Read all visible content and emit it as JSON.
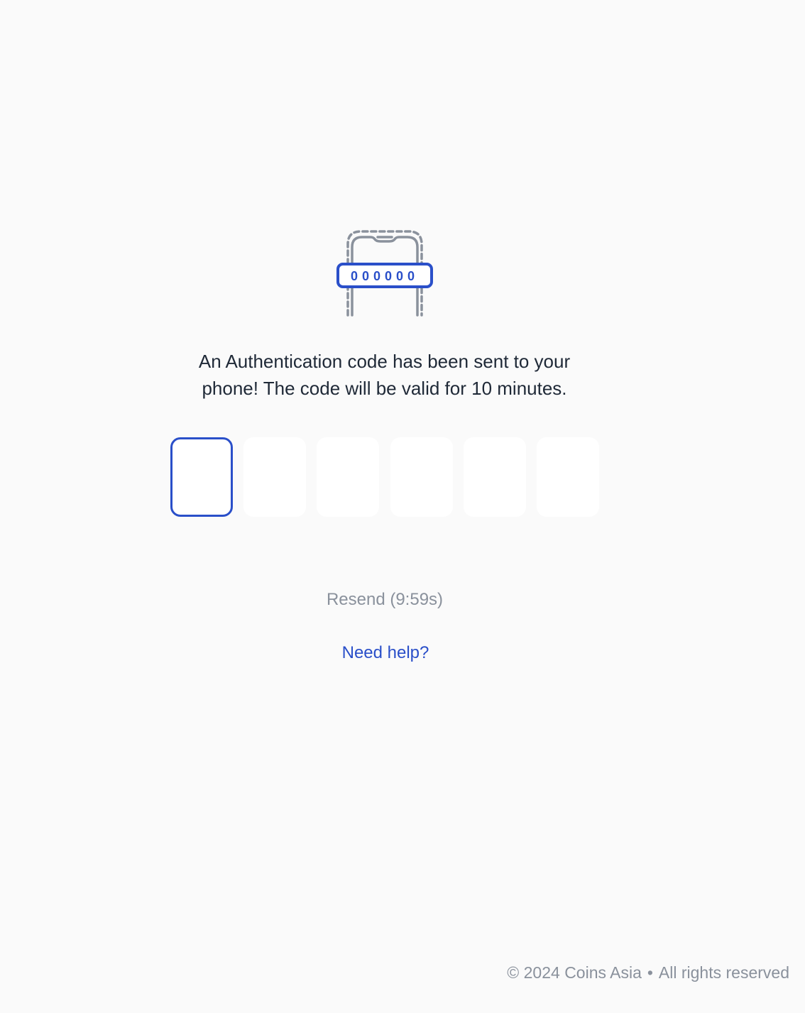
{
  "verification": {
    "message": "An Authentication code has been sent to your phone! The code will be valid for 10 minutes.",
    "code_digits": [
      "",
      "",
      "",
      "",
      "",
      ""
    ],
    "illustration_code": "000000",
    "resend_label": "Resend (9:59s)",
    "help_label": "Need help?"
  },
  "footer": {
    "copyright": "© 2024 Coins Asia",
    "separator": "•",
    "rights": "All rights reserved"
  },
  "icons": {
    "illustration": "phone-otp-icon"
  },
  "colors": {
    "accent": "#2a4fc9",
    "muted": "#8a919c",
    "text": "#1f2937",
    "background": "#fafafa",
    "input_background": "#ffffff"
  }
}
